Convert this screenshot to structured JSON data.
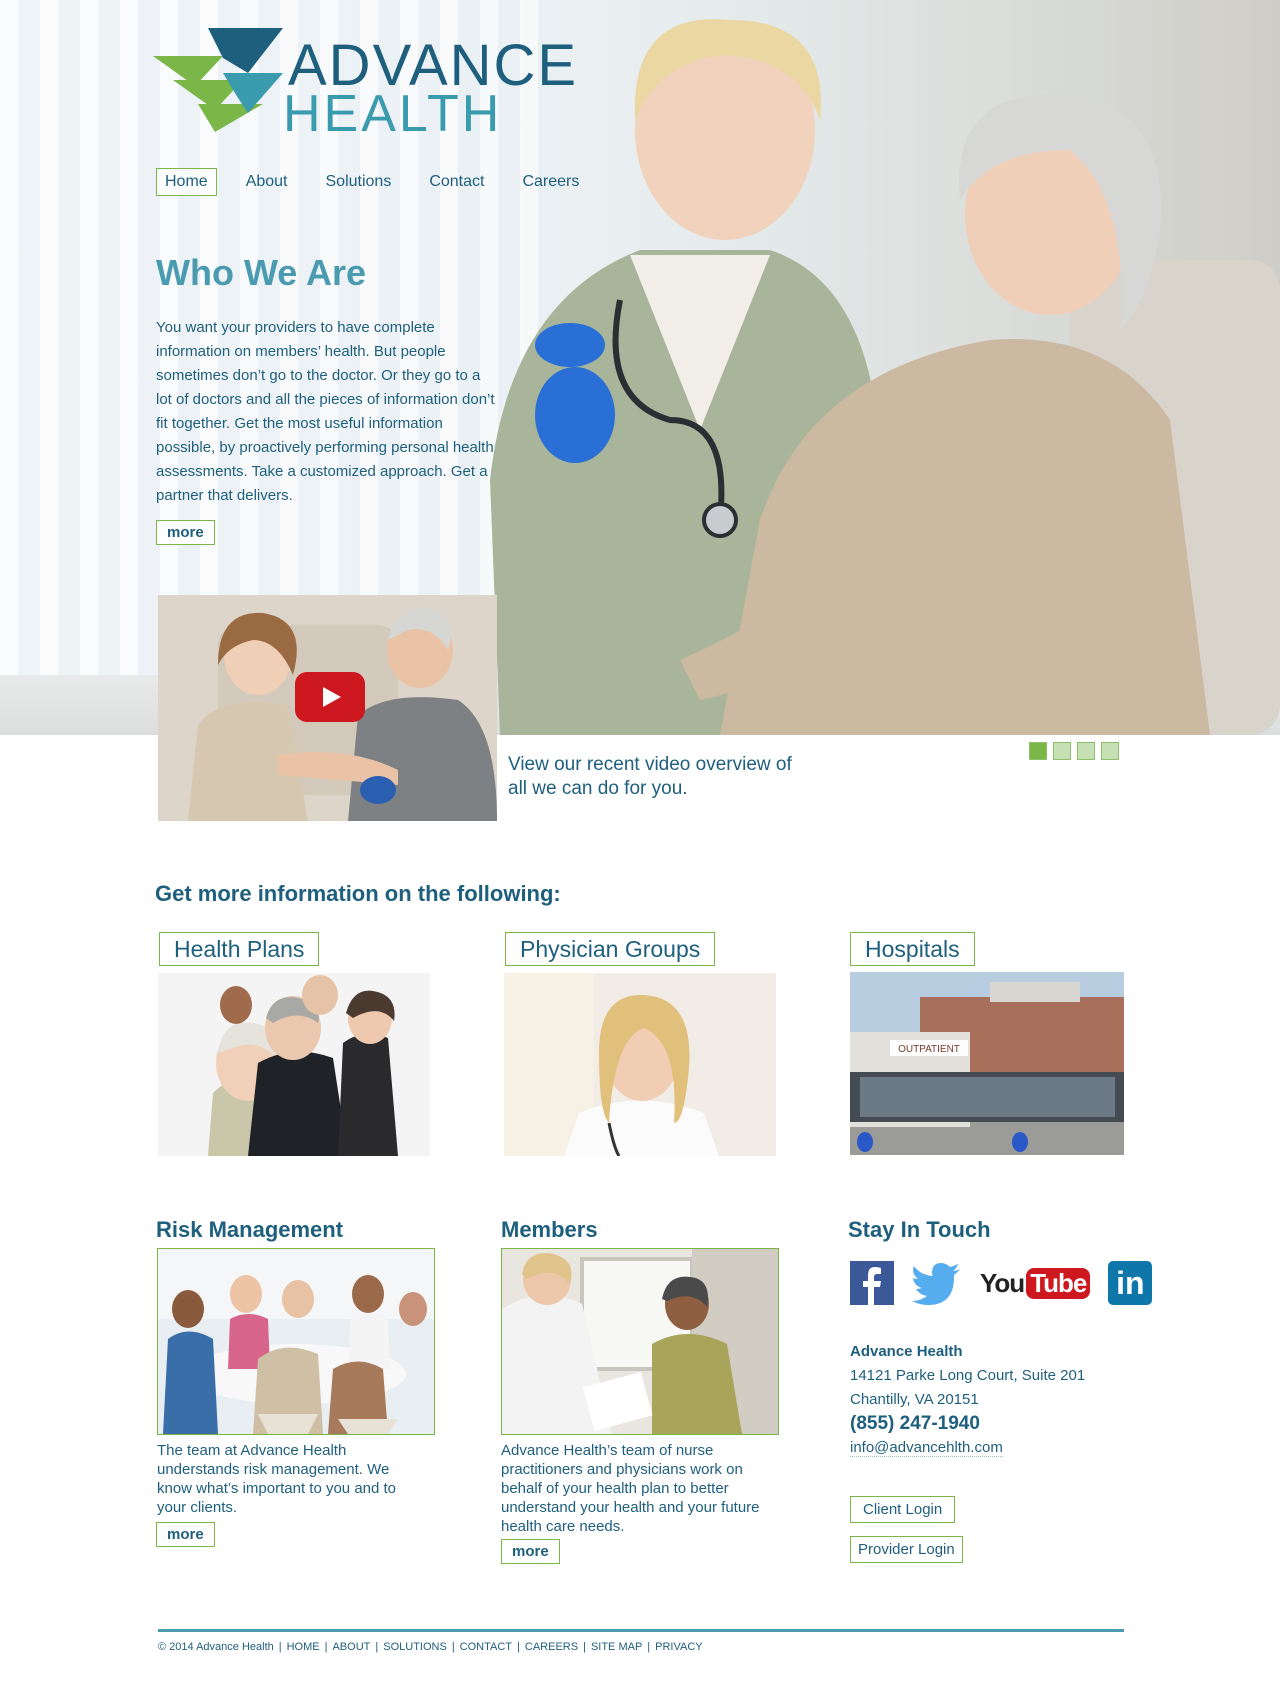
{
  "brand": {
    "line1": "ADVANCE",
    "line2": "HEALTH",
    "color_primary": "#1e5f7d",
    "color_accent": "#7ab648"
  },
  "nav": [
    {
      "label": "Home",
      "active": true
    },
    {
      "label": "About"
    },
    {
      "label": "Solutions"
    },
    {
      "label": "Contact"
    },
    {
      "label": "Careers"
    }
  ],
  "hero": {
    "title": "Who We Are",
    "text": "You want your providers to have complete information on members’ health. But people sometimes don’t go to the doctor. Or they go to a lot of doctors and all the pieces of information don’t fit together. Get the most useful information possible, by proactively performing personal health assessments. Take a customized approach. Get a partner that delivers.",
    "more_label": "more",
    "video_caption": "View our recent video overview of all we can do for you.",
    "slides": 4,
    "active_slide": 1
  },
  "info": {
    "heading": "Get more information on the following:",
    "cards": [
      {
        "label": "Health Plans"
      },
      {
        "label": "Physician Groups"
      },
      {
        "label": "Hospitals",
        "sign": "OUTPATIENT"
      }
    ]
  },
  "risk": {
    "title": "Risk Management",
    "text": "The team at Advance Health understands risk management. We know what’s important to you and to your clients.",
    "more_label": "more"
  },
  "members": {
    "title": "Members",
    "text": "Advance Health’s team of nurse practitioners and physicians work on behalf of your health plan to better understand your health and your future health care needs.",
    "more_label": "more"
  },
  "stay": {
    "title": "Stay In Touch",
    "social": [
      {
        "icon": "facebook-icon",
        "color": "#3b5998"
      },
      {
        "icon": "twitter-icon",
        "color": "#55acee"
      },
      {
        "icon": "youtube-icon",
        "text1": "You",
        "text2": "Tube",
        "color": "#cc181e"
      },
      {
        "icon": "linkedin-icon",
        "text": "in",
        "color": "#0e76a8"
      }
    ],
    "contact": {
      "org": "Advance Health",
      "address1": "14121 Parke Long Court, Suite 201",
      "address2": "Chantilly, VA 20151",
      "phone": "(855) 247-1940",
      "email": "info@advancehlth.com"
    },
    "client_login": "Client Login",
    "provider_login": "Provider Login"
  },
  "footer": {
    "copyright": "© 2014 Advance Health",
    "links": [
      "HOME",
      "ABOUT",
      "SOLUTIONS",
      "CONTACT",
      "CAREERS",
      "SITE MAP",
      "PRIVACY"
    ]
  }
}
